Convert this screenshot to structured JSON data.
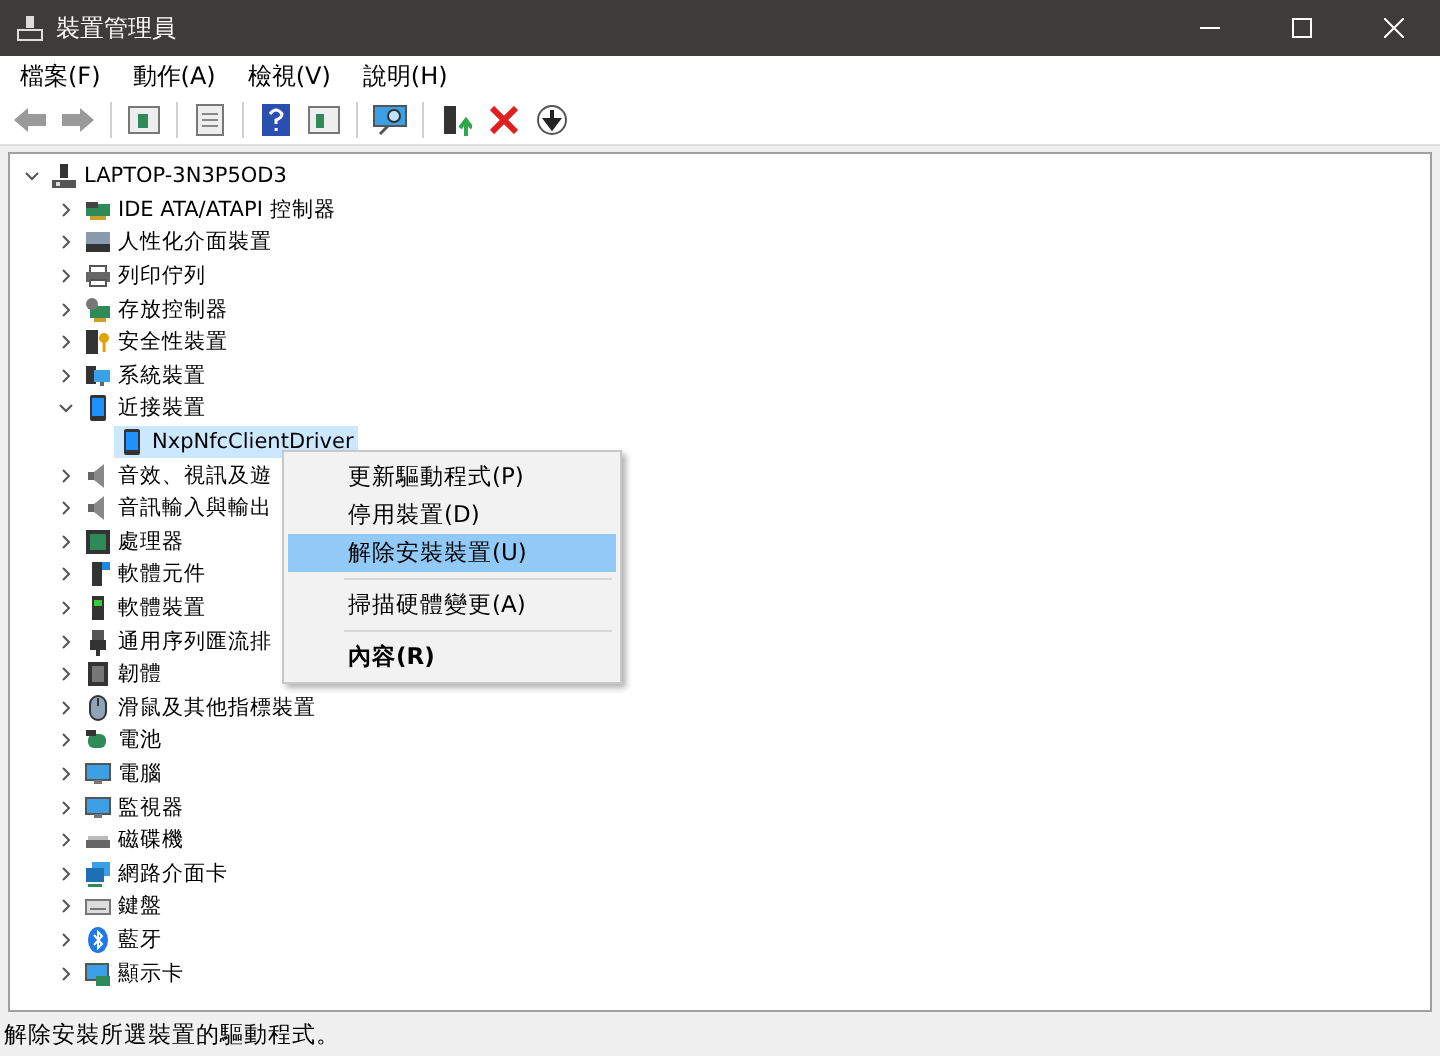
{
  "window": {
    "title": "裝置管理員"
  },
  "menu_bar": [
    {
      "label": "檔案(F)"
    },
    {
      "label": "動作(A)"
    },
    {
      "label": "檢視(V)"
    },
    {
      "label": "說明(H)"
    }
  ],
  "tree": {
    "label": "LAPTOP-3N3P5OD3",
    "expanded": true,
    "selected": false,
    "children": [
      {
        "label": "IDE ATA/ATAPI 控制器",
        "expanded": false,
        "selected": false
      },
      {
        "label": "人性化介面裝置",
        "expanded": false,
        "selected": false
      },
      {
        "label": "列印佇列",
        "expanded": false,
        "selected": false
      },
      {
        "label": "存放控制器",
        "expanded": false,
        "selected": false
      },
      {
        "label": "安全性裝置",
        "expanded": false,
        "selected": false
      },
      {
        "label": "系統裝置",
        "expanded": false,
        "selected": false
      },
      {
        "label": "近接裝置",
        "expanded": true,
        "selected": false,
        "children": [
          {
            "label": "NxpNfcClientDriver",
            "selected": true
          }
        ]
      },
      {
        "label": "音效、視訊及遊",
        "expanded": false,
        "selected": false
      },
      {
        "label": "音訊輸入與輸出",
        "expanded": false,
        "selected": false
      },
      {
        "label": "處理器",
        "expanded": false,
        "selected": false
      },
      {
        "label": "軟體元件",
        "expanded": false,
        "selected": false
      },
      {
        "label": "軟體裝置",
        "expanded": false,
        "selected": false
      },
      {
        "label": "通用序列匯流排",
        "expanded": false,
        "selected": false
      },
      {
        "label": "韌體",
        "expanded": false,
        "selected": false
      },
      {
        "label": "滑鼠及其他指標裝置",
        "expanded": false,
        "selected": false
      },
      {
        "label": "電池",
        "expanded": false,
        "selected": false
      },
      {
        "label": "電腦",
        "expanded": false,
        "selected": false
      },
      {
        "label": "監視器",
        "expanded": false,
        "selected": false
      },
      {
        "label": "磁碟機",
        "expanded": false,
        "selected": false
      },
      {
        "label": "網路介面卡",
        "expanded": false,
        "selected": false
      },
      {
        "label": "鍵盤",
        "expanded": false,
        "selected": false
      },
      {
        "label": "藍牙",
        "expanded": false,
        "selected": false
      },
      {
        "label": "顯示卡",
        "expanded": false,
        "selected": false
      }
    ]
  },
  "context_menu": [
    {
      "kind": "item",
      "label": "更新驅動程式(P)",
      "selected": false,
      "default": false
    },
    {
      "kind": "item",
      "label": "停用裝置(D)",
      "selected": false,
      "default": false
    },
    {
      "kind": "item",
      "label": "解除安裝裝置(U)",
      "selected": true,
      "default": false
    },
    {
      "kind": "separator"
    },
    {
      "kind": "item",
      "label": "掃描硬體變更(A)",
      "selected": false,
      "default": false
    },
    {
      "kind": "separator"
    },
    {
      "kind": "item",
      "label": "內容(R)",
      "selected": false,
      "default": true
    }
  ],
  "status_bar": {
    "text": "解除安裝所選裝置的驅動程式。"
  }
}
